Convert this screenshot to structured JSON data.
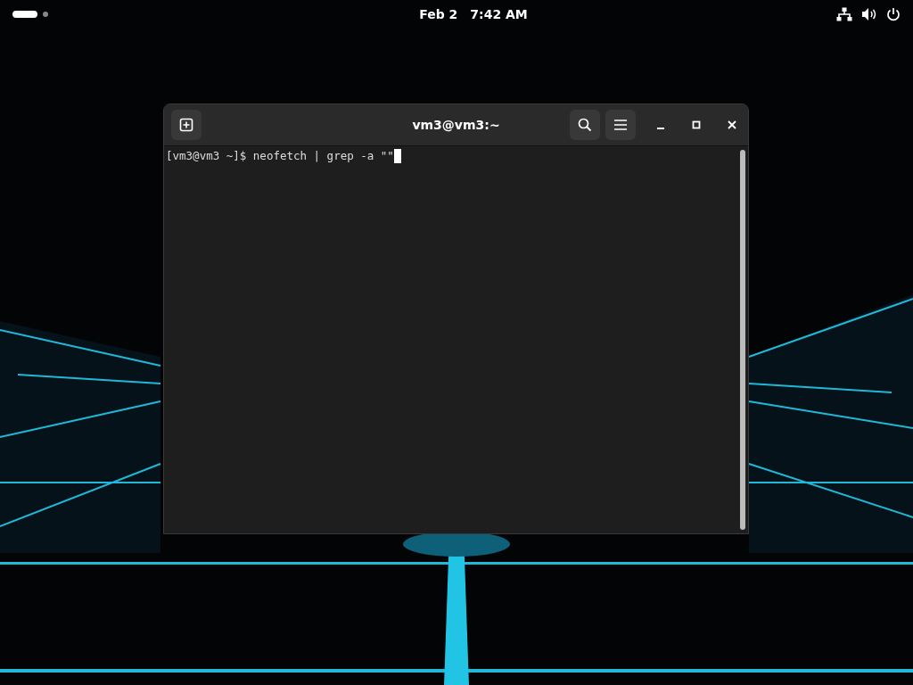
{
  "top_bar": {
    "workspaces": [
      {
        "selected": true
      },
      {
        "selected": false
      }
    ],
    "date": "Feb 2",
    "time": "7:42 AM"
  },
  "window": {
    "title": "vm3@vm3:~"
  },
  "terminal": {
    "lines": [
      "[vm3@vm3 ~]$ neofetch | grep -a \"\""
    ],
    "cursor": true
  }
}
